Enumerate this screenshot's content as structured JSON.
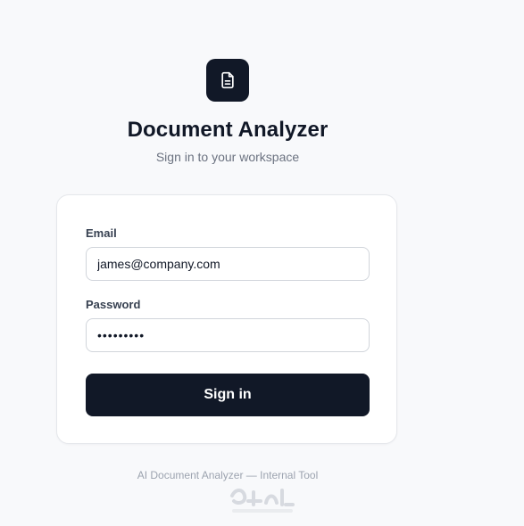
{
  "app": {
    "title": "Document Analyzer",
    "subtitle": "Sign in to your workspace",
    "icon": "document-icon"
  },
  "form": {
    "email_label": "Email",
    "email_value": "james@company.com",
    "password_label": "Password",
    "password_value": "•••••••••",
    "signin_label": "Sign in"
  },
  "footer": {
    "text": "AI Document Analyzer — Internal Tool"
  },
  "watermark": {
    "icon": "mostaql-logo"
  },
  "colors": {
    "background": "#f8f9fb",
    "primary": "#111827",
    "card": "#ffffff",
    "border": "#e5e7eb",
    "muted": "#6b7280"
  }
}
